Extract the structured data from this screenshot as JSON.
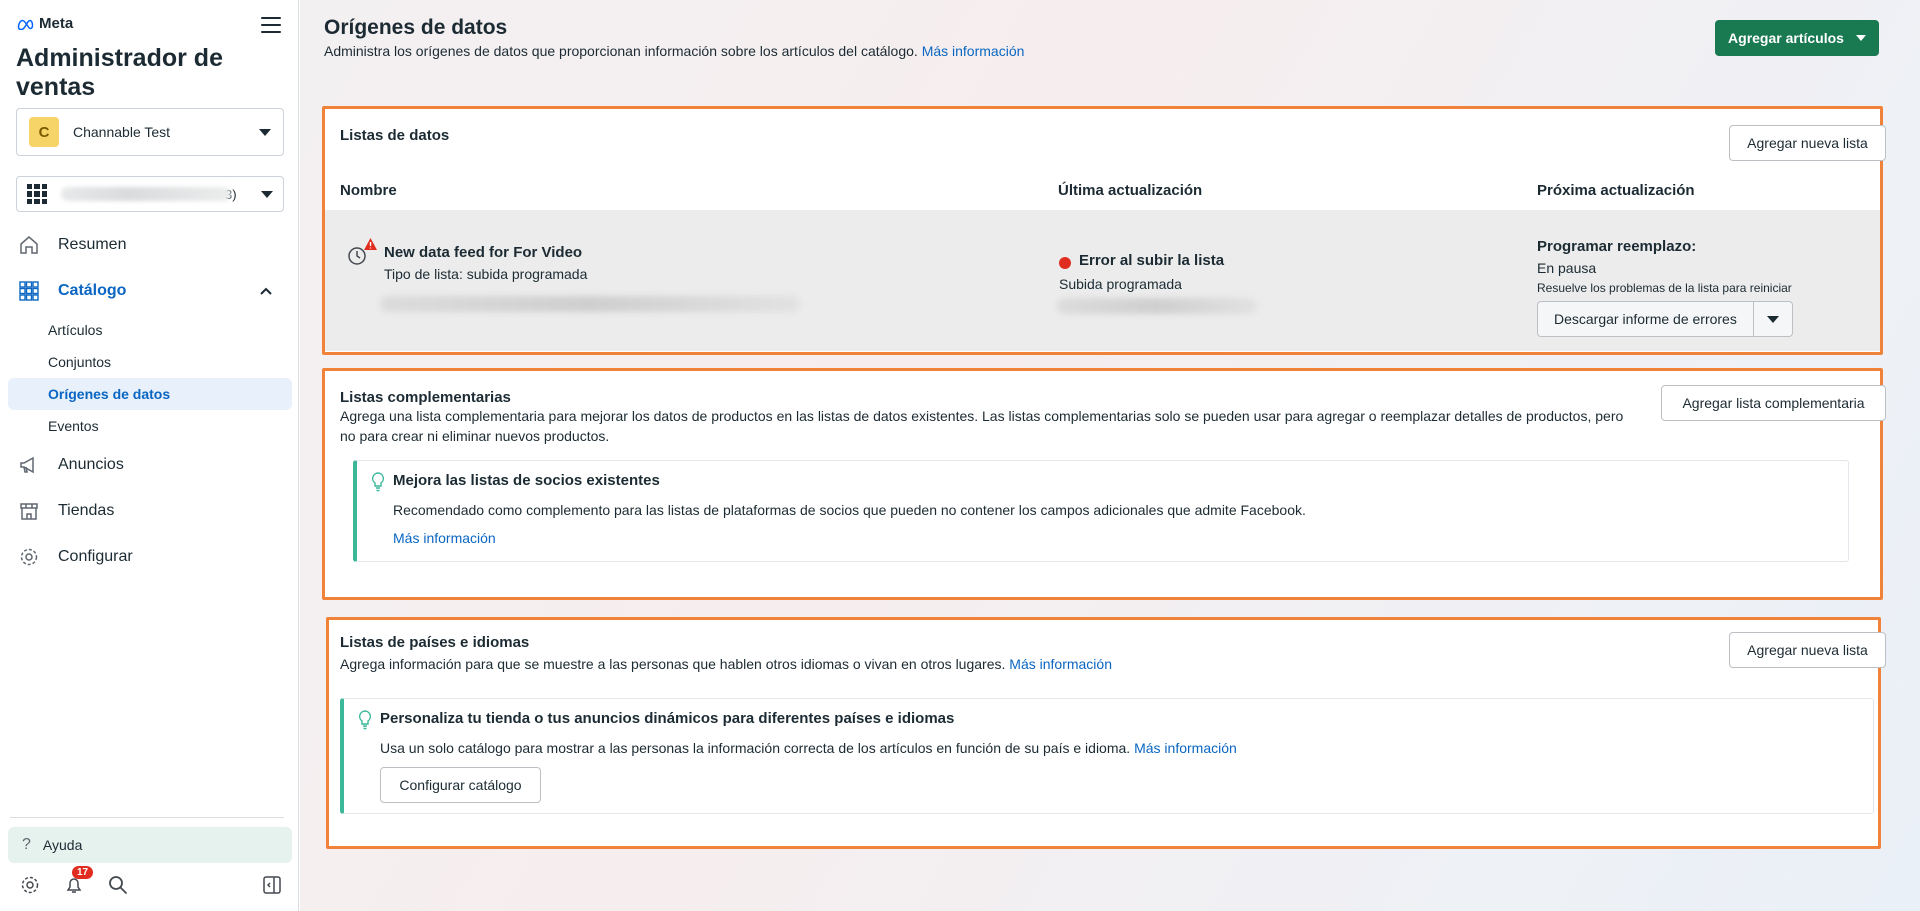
{
  "sidebar": {
    "brand": "Meta",
    "app_title": "Administrador de ventas",
    "account": {
      "initial": "C",
      "name": "Channable Test"
    },
    "catalog_suffix": "3)",
    "nav": {
      "summary": "Resumen",
      "catalog": "Catálogo",
      "catalog_items": [
        "Artículos",
        "Conjuntos",
        "Orígenes de datos",
        "Eventos"
      ],
      "ads": "Anuncios",
      "stores": "Tiendas",
      "settings": "Configurar"
    },
    "help": "Ayuda",
    "notifications_count": "17"
  },
  "header": {
    "title": "Orígenes de datos",
    "description": "Administra los orígenes de datos que proporcionan información sobre los artículos del catálogo.",
    "more_info": "Más información",
    "primary_button": "Agregar artículos"
  },
  "data_lists": {
    "title": "Listas de datos",
    "add_button": "Agregar nueva lista",
    "columns": [
      "Nombre",
      "Última actualización",
      "Próxima actualización"
    ],
    "row": {
      "name": "New data feed for For Video",
      "type": "Tipo de lista: subida programada",
      "status": "Error al subir la lista",
      "status_sub": "Subida programada",
      "next_head": "Programar reemplazo:",
      "next_state": "En pausa",
      "next_hint": "Resuelve los problemas de la lista para reiniciar",
      "download_button": "Descargar informe de errores"
    }
  },
  "supplementary": {
    "title": "Listas complementarias",
    "description": "Agrega una lista complementaria para mejorar los datos de productos en las listas de datos existentes. Las listas complementarias solo se pueden usar para agregar o reemplazar detalles de productos, pero no para crear ni eliminar nuevos productos.",
    "add_button": "Agregar lista complementaria",
    "tip": {
      "title": "Mejora las listas de socios existentes",
      "text": "Recomendado como complemento para las listas de plataformas de socios que pueden no contener los campos adicionales que admite Facebook.",
      "link": "Más información"
    }
  },
  "countries": {
    "title": "Listas de países e idiomas",
    "description": "Agrega información para que se muestre a las personas que hablen otros idiomas o vivan en otros lugares.",
    "link": "Más información",
    "add_button": "Agregar nueva lista",
    "tip": {
      "title": "Personaliza tu tienda o tus anuncios dinámicos para diferentes países e idiomas",
      "text": "Usa un solo catálogo para mostrar a las personas la información correcta de los artículos en función de su país e idioma.",
      "link": "Más información",
      "button": "Configurar catálogo"
    }
  },
  "colors": {
    "primary": "#197a52",
    "link": "#0a66c2",
    "highlight": "#f0823a",
    "error": "#e02d20",
    "tip_accent": "#3bb89a"
  }
}
